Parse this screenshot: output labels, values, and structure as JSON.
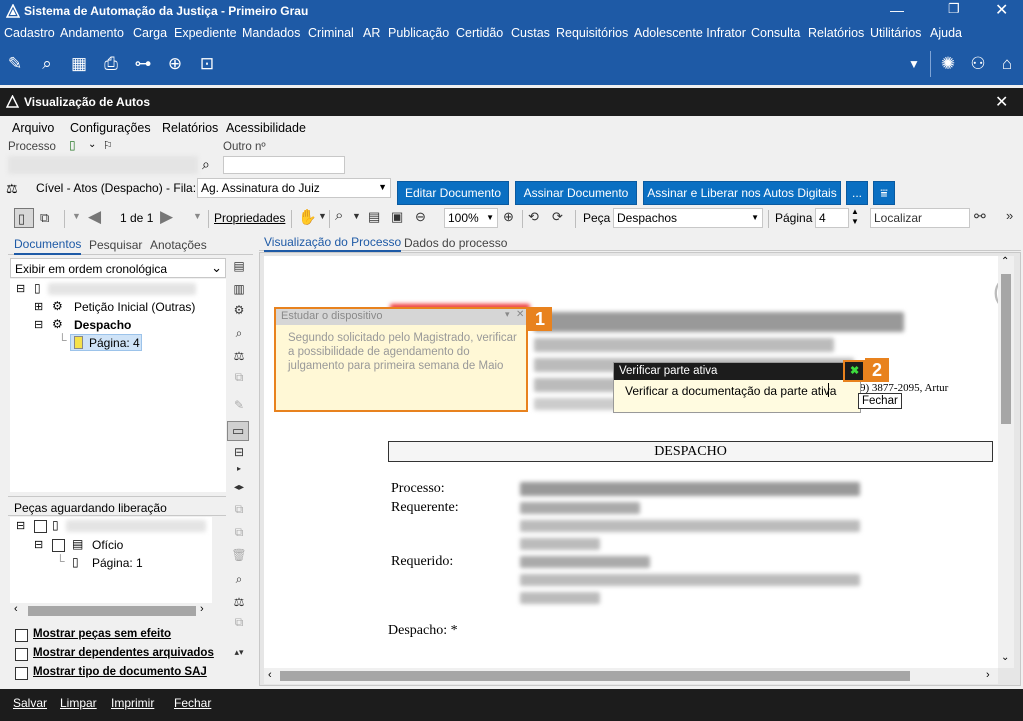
{
  "app": {
    "title": "Sistema de Automação da Justiça - Primeiro Grau"
  },
  "menu": [
    "Cadastro",
    "Andamento",
    "Carga",
    "Expediente",
    "Mandados",
    "Criminal",
    "AR",
    "Publicação",
    "Certidão",
    "Custas",
    "Requisitórios",
    "Adolescente Infrator",
    "Consulta",
    "Relatórios",
    "Utilitários",
    "Ajuda"
  ],
  "window": {
    "title": "Visualização de Autos"
  },
  "inner_menu": [
    "Arquivo",
    "Configurações",
    "Relatórios",
    "Acessibilidade"
  ],
  "fields": {
    "processo_label": "Processo",
    "outro_label": "Outro nº"
  },
  "fila": {
    "label": "Cível - Atos (Despacho) - Fila:",
    "value": "Ag. Assinatura do Juiz"
  },
  "buttons": {
    "editar": "Editar Documento",
    "assinar": "Assinar Documento",
    "assinar_liberar": "Assinar e Liberar nos Autos Digitais",
    "more": "..."
  },
  "nav": {
    "page_count": "1 de 1",
    "propriedades": "Propriedades",
    "zoom": "100%",
    "peca_label": "Peça",
    "peca_value": "Despachos",
    "pagina_label": "Página",
    "pagina_value": "4",
    "localizar_placeholder": "Localizar"
  },
  "left_tabs": [
    "Documentos",
    "Pesquisar",
    "Anotações"
  ],
  "order": "Exibir em ordem cronológica",
  "tree": {
    "peticao": "Petição Inicial (Outras)",
    "despacho": "Despacho",
    "pagina": "Página: 4"
  },
  "pecas": {
    "title": "Peças aguardando liberação",
    "oficio": "Ofício",
    "pagina": "Página: 1"
  },
  "checkboxes": [
    "Mostrar peças sem efeito",
    "Mostrar dependentes arquivados",
    "Mostrar tipo de documento SAJ"
  ],
  "view_tabs": [
    "Visualização do Processo",
    "Dados do processo"
  ],
  "note1": {
    "title": "Estudar o dispositivo",
    "text": "Segundo solicitado pelo Magistrado, verificar a possibilidade de agendamento do julgamento para primeira semana de Maio",
    "badge": "1"
  },
  "note2": {
    "title": "Verificar parte ativa",
    "text": "Verificar a documentação da parte ativa",
    "badge": "2",
    "tooltip": "Fechar"
  },
  "document": {
    "header_fragment": "9) 3877-2095, Artur",
    "title": "DESPACHO",
    "processo": "Processo:",
    "requerente": "Requerente:",
    "requerido": "Requerido:",
    "despacho": "Despacho: *"
  },
  "bottom": [
    "Salvar",
    "Limpar",
    "Imprimir",
    "Fechar"
  ],
  "colors": {
    "brand": "#1e5aa6",
    "accent_orange": "#e8821e",
    "button_blue": "#0a6fc2"
  }
}
